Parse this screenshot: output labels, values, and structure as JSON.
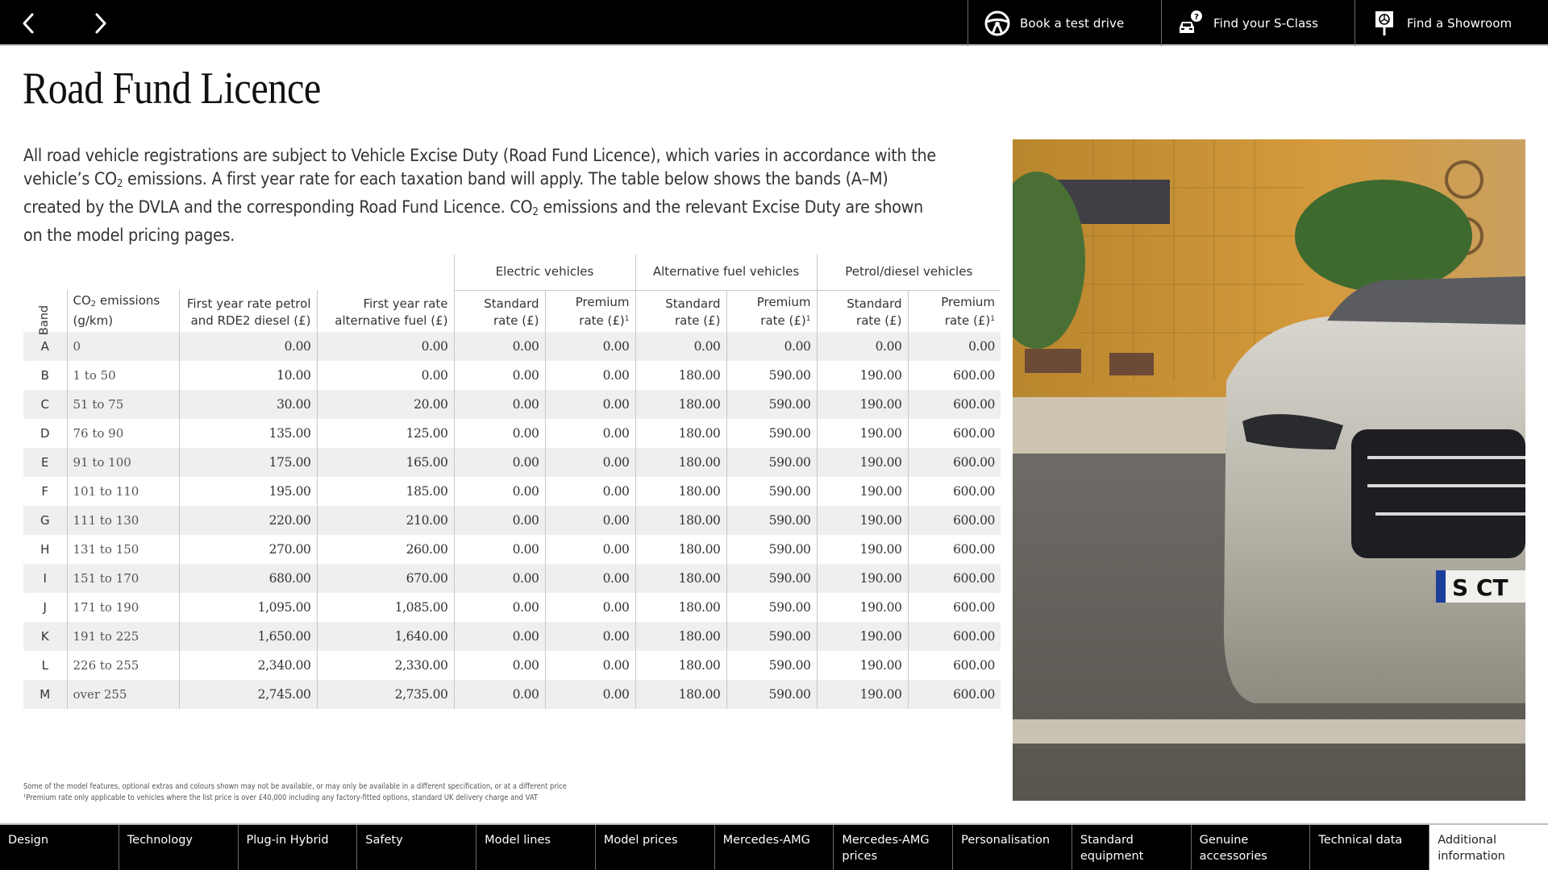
{
  "topbar": {
    "prev_icon": "chevron-left-icon",
    "next_icon": "chevron-right-icon",
    "actions": [
      {
        "label": "Book a test drive",
        "icon": "steering-wheel-icon"
      },
      {
        "label": "Find your S-Class",
        "icon": "car-question-icon"
      },
      {
        "label": "Find a Showroom",
        "icon": "showroom-sign-icon"
      }
    ]
  },
  "page": {
    "title": "Road Fund Licence",
    "intro": {
      "part1": "All road vehicle registrations are subject to Vehicle Excise Duty (Road Fund Licence), which varies in accordance with the vehicle’s CO",
      "sub1": "2",
      "part2": " emissions. A first year rate for each taxation band will apply. The table below shows the bands (A–M) created by the DVLA and the corresponding Road Fund Licence. CO",
      "sub2": "2",
      "part3": " emissions and the relevant Excise Duty are shown on the model pricing pages."
    }
  },
  "table": {
    "groups": [
      "Electric vehicles",
      "Alternative fuel vehicles",
      "Petrol/diesel vehicles"
    ],
    "headers": {
      "band": "Band",
      "co2_pre": "CO",
      "co2_sub": "2",
      "co2_post": " emissions",
      "co2_unit": "(g/km)",
      "first_petrol_l1": "First year rate petrol",
      "first_petrol_l2": "and RDE2 diesel (£)",
      "first_alt_l1": "First year rate",
      "first_alt_l2": "alternative fuel (£)",
      "standard_l1": "Standard",
      "standard_l2": "rate (£)",
      "premium_l1": "Premium",
      "premium_l2": "rate (£)",
      "premium_sup": "1"
    },
    "rows": [
      {
        "band": "A",
        "co2": "0",
        "first_petrol": "0.00",
        "first_alt": "0.00",
        "ev_std": "0.00",
        "ev_prem": "0.00",
        "alt_std": "0.00",
        "alt_prem": "0.00",
        "pd_std": "0.00",
        "pd_prem": "0.00"
      },
      {
        "band": "B",
        "co2": "1 to 50",
        "first_petrol": "10.00",
        "first_alt": "0.00",
        "ev_std": "0.00",
        "ev_prem": "0.00",
        "alt_std": "180.00",
        "alt_prem": "590.00",
        "pd_std": "190.00",
        "pd_prem": "600.00"
      },
      {
        "band": "C",
        "co2": "51 to 75",
        "first_petrol": "30.00",
        "first_alt": "20.00",
        "ev_std": "0.00",
        "ev_prem": "0.00",
        "alt_std": "180.00",
        "alt_prem": "590.00",
        "pd_std": "190.00",
        "pd_prem": "600.00"
      },
      {
        "band": "D",
        "co2": "76 to 90",
        "first_petrol": "135.00",
        "first_alt": "125.00",
        "ev_std": "0.00",
        "ev_prem": "0.00",
        "alt_std": "180.00",
        "alt_prem": "590.00",
        "pd_std": "190.00",
        "pd_prem": "600.00"
      },
      {
        "band": "E",
        "co2": "91 to 100",
        "first_petrol": "175.00",
        "first_alt": "165.00",
        "ev_std": "0.00",
        "ev_prem": "0.00",
        "alt_std": "180.00",
        "alt_prem": "590.00",
        "pd_std": "190.00",
        "pd_prem": "600.00"
      },
      {
        "band": "F",
        "co2": "101 to 110",
        "first_petrol": "195.00",
        "first_alt": "185.00",
        "ev_std": "0.00",
        "ev_prem": "0.00",
        "alt_std": "180.00",
        "alt_prem": "590.00",
        "pd_std": "190.00",
        "pd_prem": "600.00"
      },
      {
        "band": "G",
        "co2": "111 to 130",
        "first_petrol": "220.00",
        "first_alt": "210.00",
        "ev_std": "0.00",
        "ev_prem": "0.00",
        "alt_std": "180.00",
        "alt_prem": "590.00",
        "pd_std": "190.00",
        "pd_prem": "600.00"
      },
      {
        "band": "H",
        "co2": "131 to 150",
        "first_petrol": "270.00",
        "first_alt": "260.00",
        "ev_std": "0.00",
        "ev_prem": "0.00",
        "alt_std": "180.00",
        "alt_prem": "590.00",
        "pd_std": "190.00",
        "pd_prem": "600.00"
      },
      {
        "band": "I",
        "co2": "151 to 170",
        "first_petrol": "680.00",
        "first_alt": "670.00",
        "ev_std": "0.00",
        "ev_prem": "0.00",
        "alt_std": "180.00",
        "alt_prem": "590.00",
        "pd_std": "190.00",
        "pd_prem": "600.00"
      },
      {
        "band": "J",
        "co2": "171 to 190",
        "first_petrol": "1,095.00",
        "first_alt": "1,085.00",
        "ev_std": "0.00",
        "ev_prem": "0.00",
        "alt_std": "180.00",
        "alt_prem": "590.00",
        "pd_std": "190.00",
        "pd_prem": "600.00"
      },
      {
        "band": "K",
        "co2": "191 to 225",
        "first_petrol": "1,650.00",
        "first_alt": "1,640.00",
        "ev_std": "0.00",
        "ev_prem": "0.00",
        "alt_std": "180.00",
        "alt_prem": "590.00",
        "pd_std": "190.00",
        "pd_prem": "600.00"
      },
      {
        "band": "L",
        "co2": "226 to 255",
        "first_petrol": "2,340.00",
        "first_alt": "2,330.00",
        "ev_std": "0.00",
        "ev_prem": "0.00",
        "alt_std": "180.00",
        "alt_prem": "590.00",
        "pd_std": "190.00",
        "pd_prem": "600.00"
      },
      {
        "band": "M",
        "co2": "over 255",
        "first_petrol": "2,745.00",
        "first_alt": "2,735.00",
        "ev_std": "0.00",
        "ev_prem": "0.00",
        "alt_std": "180.00",
        "alt_prem": "590.00",
        "pd_std": "190.00",
        "pd_prem": "600.00"
      }
    ]
  },
  "photo": {
    "alt": "Silver Mercedes-Benz S-Class parked in front of an orange tiled building",
    "plate_text": "S CT"
  },
  "footnotes": [
    "Some of the model features, optional extras and colours shown may not be available, or may only be available in a different specification, or at a different price",
    "¹Premium rate only applicable to vehicles where the list price is over £40,000 including any factory-fitted options, standard UK delivery charge and VAT"
  ],
  "bottom_nav": {
    "active_index": 12,
    "items": [
      {
        "label": "Design"
      },
      {
        "label": "Technology"
      },
      {
        "label": "Plug-in Hybrid"
      },
      {
        "label": "Safety"
      },
      {
        "label": "Model lines"
      },
      {
        "label": "Model prices"
      },
      {
        "label": "Mercedes-AMG"
      },
      {
        "label": "Mercedes-AMG prices"
      },
      {
        "label": "Personalisation"
      },
      {
        "label": "Standard equipment"
      },
      {
        "label": "Genuine accessories"
      },
      {
        "label": "Technical data"
      },
      {
        "label": "Additional information"
      }
    ]
  },
  "colors": {
    "bar_bg": "#000000",
    "row_stripe": "#efefef",
    "divider": "#c8c8c8",
    "active_tab_bg": "#ffffff"
  }
}
